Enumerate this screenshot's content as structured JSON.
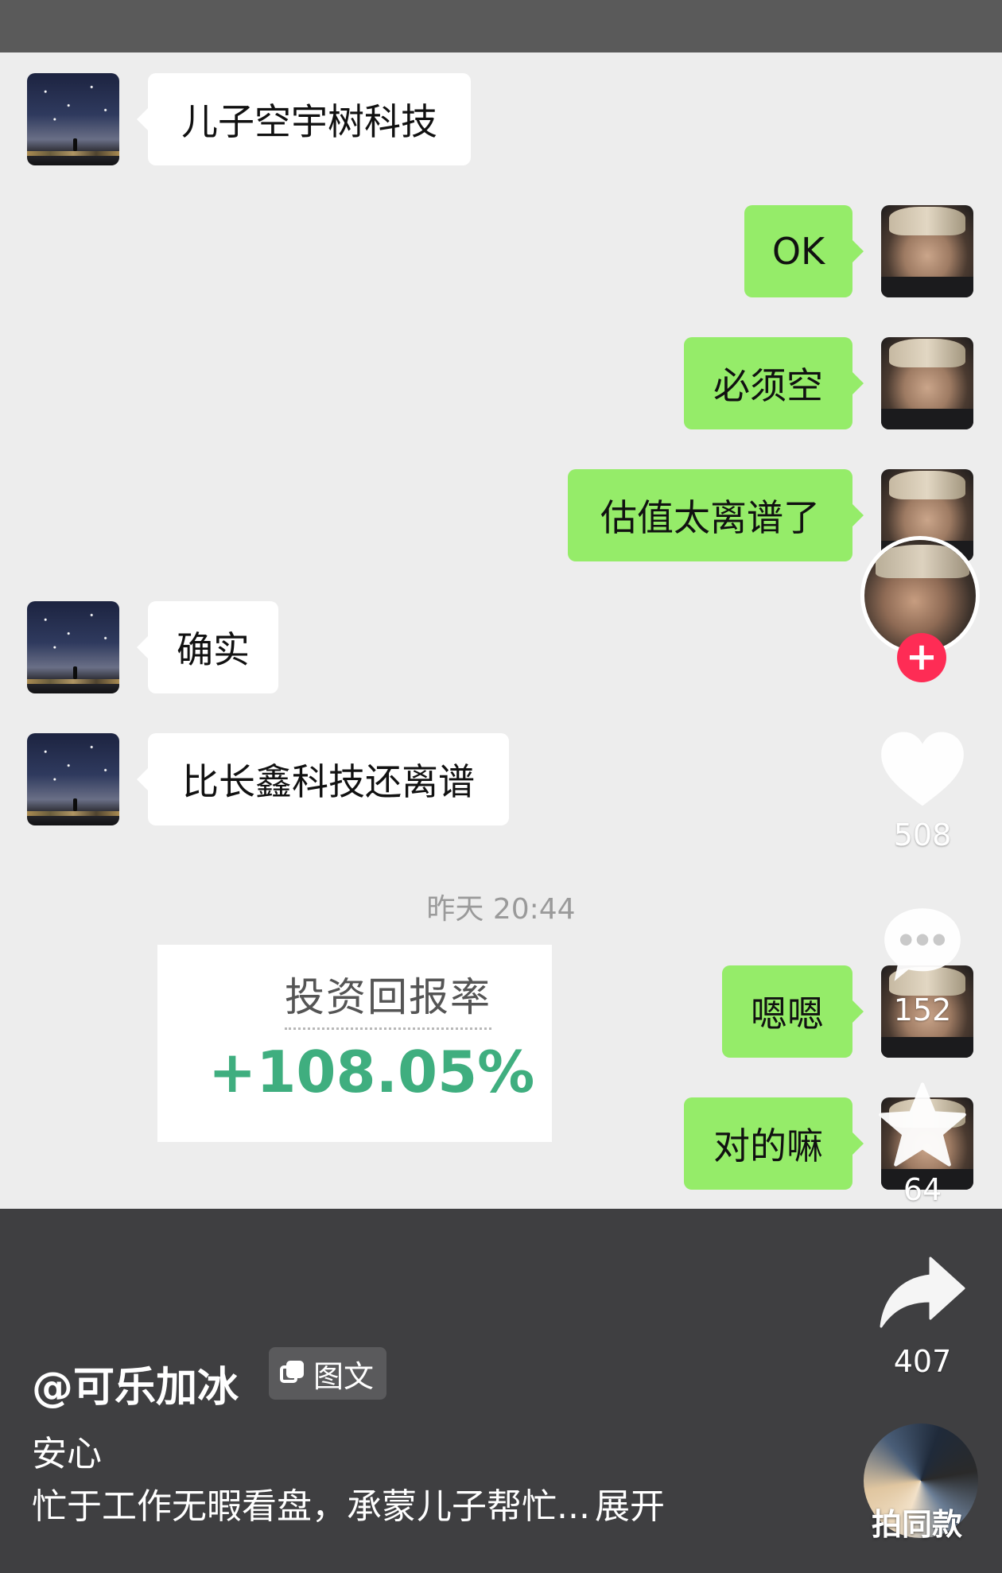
{
  "chat": {
    "messages": [
      {
        "side": "left",
        "text": "儿子空宇树科技"
      },
      {
        "side": "right",
        "text": "OK"
      },
      {
        "side": "right",
        "text": "必须空"
      },
      {
        "side": "right",
        "text": "估值太离谱了"
      },
      {
        "side": "left",
        "text": "确实"
      },
      {
        "side": "left",
        "text": "比长鑫科技还离谱"
      },
      {
        "side": "right",
        "text": "嗯嗯"
      },
      {
        "side": "right",
        "text": "对的嘛"
      }
    ],
    "timestamp": "昨天 20:44",
    "roi_card": {
      "label": "投资回报率",
      "value": "+108.05%"
    }
  },
  "rail": {
    "follow_icon": "plus-icon",
    "likes": "508",
    "comments": "152",
    "favorites": "64",
    "shares": "407",
    "music_label": "拍同款"
  },
  "post": {
    "username": "@可乐加冰",
    "tag": "图文",
    "caption_line1": "安心",
    "caption_line2": "忙于工作无暇看盘，承蒙儿子帮忙...",
    "expand": "展开"
  },
  "colors": {
    "bubble_right": "#95ec69",
    "bubble_left": "#ffffff",
    "roi_green": "#3fae7f",
    "follow_red": "#fe2c55"
  }
}
